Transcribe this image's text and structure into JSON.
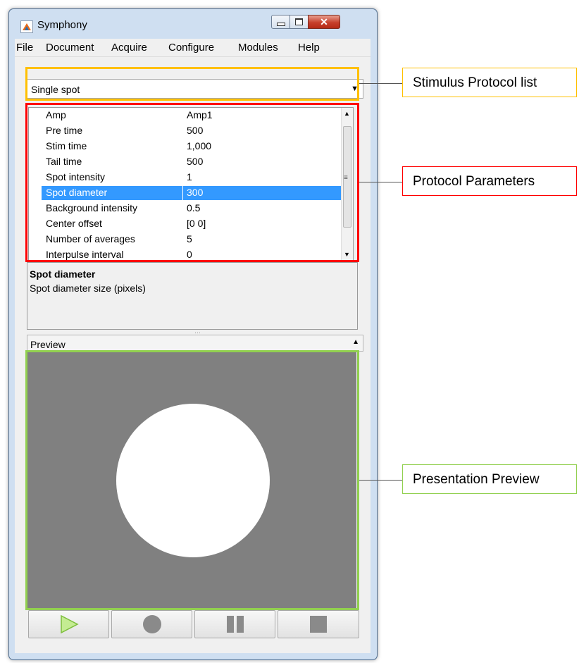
{
  "window": {
    "title": "Symphony",
    "icon": "matlab-icon",
    "controls": {
      "minimize": "minimize-icon",
      "maximize": "maximize-icon",
      "close": "✕"
    }
  },
  "menu": [
    "File",
    "Document",
    "Acquire",
    "Configure",
    "Modules",
    "Help"
  ],
  "protocol": {
    "selected": "Single spot"
  },
  "parameters": [
    {
      "name": "Amp",
      "value": "Amp1"
    },
    {
      "name": "Pre time",
      "value": "500"
    },
    {
      "name": "Stim time",
      "value": "1,000"
    },
    {
      "name": "Tail time",
      "value": "500"
    },
    {
      "name": "Spot intensity",
      "value": "1"
    },
    {
      "name": "Spot diameter",
      "value": "300",
      "selected": true
    },
    {
      "name": "Background intensity",
      "value": "0.5"
    },
    {
      "name": "Center offset",
      "value": "[0 0]"
    },
    {
      "name": "Number of averages",
      "value": "5"
    },
    {
      "name": "Interpulse interval",
      "value": "0"
    }
  ],
  "description": {
    "title": "Spot diameter",
    "text": "Spot diameter size (pixels)"
  },
  "preview": {
    "label": "Preview",
    "background_color": "#808080",
    "spot_color": "#ffffff"
  },
  "controls": [
    "play-icon",
    "record-icon",
    "pause-icon",
    "stop-icon"
  ],
  "annotations": {
    "protocol_list": "Stimulus Protocol list",
    "protocol_parameters": "Protocol Parameters",
    "presentation_preview": "Presentation Preview"
  },
  "colors": {
    "protocol_list": "#ffc000",
    "protocol_parameters": "#ff0000",
    "presentation_preview": "#92d050",
    "selection": "#3399ff",
    "play": "#8fd14f"
  }
}
